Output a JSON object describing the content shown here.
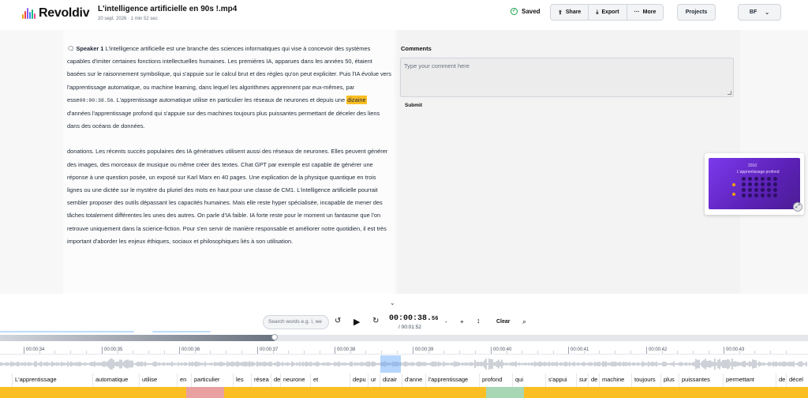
{
  "app": {
    "name": "Revoldiv"
  },
  "file": {
    "title": "L'intelligence artificielle en 90s !.mp4",
    "meta": "20 sept. 2026 · 1 min 52 sec"
  },
  "header": {
    "saved": "Saved",
    "share": "Share",
    "export": "Export",
    "more": "More",
    "projects": "Projects",
    "user": "BF"
  },
  "transcript": {
    "speaker": "Speaker 1",
    "p1_a": "L'intelligence artificielle est une branche des sciences informatiques qui vise à concevoir des systèmes capables d'imiter certaines fonctions intellectuelles humaines. Les premières IA, apparues dans les années 50, étaient basées sur le raisonnement symbolique, qui s'appuie sur le calcul brut et des règles qu'on peut expliciter. Puis l'IA évolue vers l'apprentissage automatique, ou machine learning, dans lequel les algorithmes apprennent par eux-mêmes, par esse",
    "timestamp": "00:00:38.56",
    "p1_b": ". L'apprentissage automatique utilise en particulier les réseaux de neurones et depuis une ",
    "highlight": "dizaine",
    "p1_c": " d'années l'apprentissage profond qui s'appuie sur des machines toujours plus puissantes permettant de déceler des liens dans des océans de données.",
    "p2": "donations. Les récents succès populaires des IA génératives utilisent aussi des réseaux de neurones. Elles peuvent générer des images, des morceaux de musique ou même créer des textes. Chat GPT par exemple est capable de générer une réponse à une question posée, un exposé sur Karl Marx en 40 pages. Une explication de la physique quantique en trois lignes ou une dictée sur le mystère du pluriel des mots en haut pour une classe de CM1. L'intelligence artificielle pourrait sembler proposer des outils dépassant les capacités humaines. Mais elle reste hyper spécialisée, incapable de mener des tâches totalement différentes les unes des autres. On parle d'IA faible. IA forte reste pour le moment un fantasme que l'on retrouve uniquement dans la science-fiction. Pour s'en servir de manière responsable et améliorer notre quotidien, il est très important d'aborder les enjeux éthiques, sociaux et philosophiques liés à son utilisation."
  },
  "comments": {
    "title": "Comments",
    "placeholder": "Type your comment here",
    "submit": "Submit"
  },
  "video": {
    "year": "2010",
    "caption": "L'apprentissage profond"
  },
  "player": {
    "search_placeholder": "Search words e.g. I, we",
    "time_main": "00:00:38.",
    "time_ms": "56",
    "time_total": "/ 00:01:52",
    "minus": "-",
    "plus": "+",
    "clear": "Clear",
    "progress": 0.34
  },
  "timeline": {
    "ticks": [
      "00:00:34",
      "00:00:35",
      "00:00:36",
      "00:00:37",
      "00:00:38",
      "00:00:39",
      "00:00:40",
      "00:00:41",
      "00:00:42",
      "00:00:43"
    ],
    "words": [
      "L'apprentissage",
      "automatique",
      "utilise",
      "en",
      "particulier",
      "les",
      "résea",
      "de",
      "neurone",
      "et",
      "depu",
      "ur",
      "dizair",
      "d'anne",
      "l'apprentissage",
      "profond",
      "qui",
      "s'appui",
      "sur",
      "de",
      "machine",
      "toujours",
      "plus",
      "puissantes",
      "permettant",
      "de",
      "décel"
    ]
  },
  "colors": {
    "accent": "#fbbf24",
    "pink": "#e8a0a0",
    "green": "#a7d7b4",
    "playhead": "#60a5fa"
  }
}
